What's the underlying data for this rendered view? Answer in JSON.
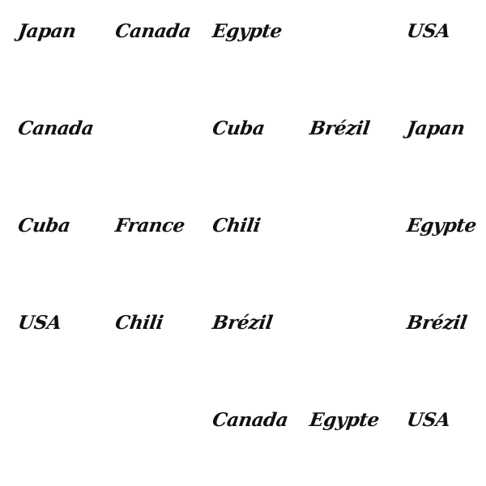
{
  "grid": {
    "rows": [
      [
        "Japan",
        "Canada",
        "Egypte",
        "",
        "USA"
      ],
      [
        "Canada",
        "",
        "Cuba",
        "Brézil",
        "Japan"
      ],
      [
        "Cuba",
        "France",
        "Chili",
        "",
        "Egypte"
      ],
      [
        "USA",
        "Chili",
        "Brézil",
        "",
        "Brézil"
      ],
      [
        "",
        "",
        "Canada",
        "Egypte",
        "USA"
      ]
    ]
  },
  "colors": {
    "background": "#ffffff",
    "text": "#111111"
  }
}
